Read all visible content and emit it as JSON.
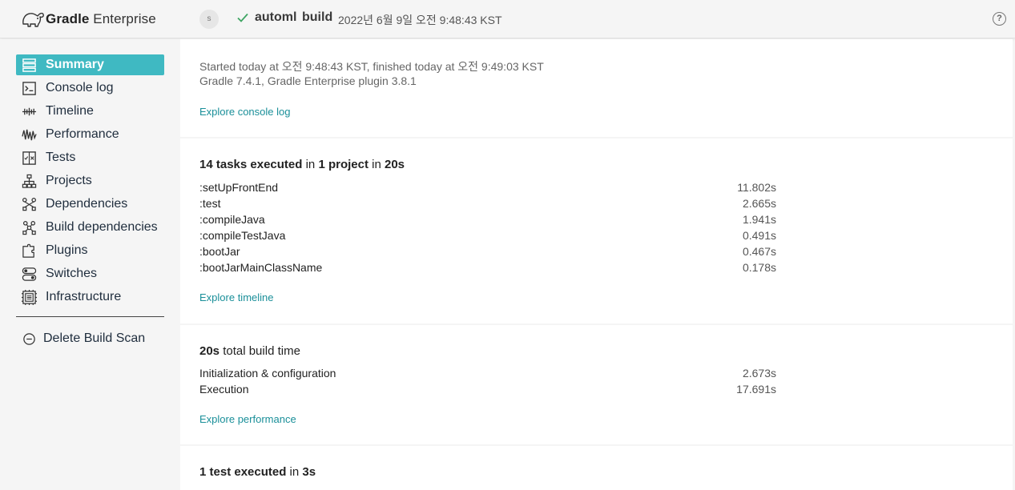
{
  "header": {
    "logo_brand": "Gradle",
    "logo_product": "Enterprise",
    "avatar_initial": "s",
    "project": "automl",
    "task": "build",
    "timestamp": "2022년 6월 9일 오전 9:48:43 KST",
    "help_label": "?",
    "colors": {
      "success": "#3fa564",
      "accent": "#3fb9c2",
      "link": "#1a8f99"
    }
  },
  "sidebar": {
    "items": [
      {
        "label": "Summary",
        "icon": "summary-icon",
        "active": true
      },
      {
        "label": "Console log",
        "icon": "console-icon",
        "active": false
      },
      {
        "label": "Timeline",
        "icon": "timeline-icon",
        "active": false
      },
      {
        "label": "Performance",
        "icon": "performance-icon",
        "active": false
      },
      {
        "label": "Tests",
        "icon": "tests-icon",
        "active": false
      },
      {
        "label": "Projects",
        "icon": "projects-icon",
        "active": false
      },
      {
        "label": "Dependencies",
        "icon": "dependencies-icon",
        "active": false
      },
      {
        "label": "Build dependencies",
        "icon": "build-dependencies-icon",
        "active": false
      },
      {
        "label": "Plugins",
        "icon": "plugins-icon",
        "active": false
      },
      {
        "label": "Switches",
        "icon": "switches-icon",
        "active": false
      },
      {
        "label": "Infrastructure",
        "icon": "infrastructure-icon",
        "active": false
      }
    ],
    "delete_label": "Delete Build Scan"
  },
  "overview": {
    "started": "Started today at 오전 9:48:43 KST, finished today at 오전 9:49:03 KST",
    "versions": "Gradle 7.4.1,  Gradle Enterprise plugin 3.8.1",
    "link": "Explore console log"
  },
  "tasks": {
    "title_count": "14 tasks executed",
    "title_mid1": " in ",
    "title_projects": "1 project",
    "title_mid2": " in ",
    "title_time": "20s",
    "rows": [
      {
        "name": ":setUpFrontEnd",
        "value": "11.802s"
      },
      {
        "name": ":test",
        "value": "2.665s"
      },
      {
        "name": ":compileJava",
        "value": "1.941s"
      },
      {
        "name": ":compileTestJava",
        "value": "0.491s"
      },
      {
        "name": ":bootJar",
        "value": "0.467s"
      },
      {
        "name": ":bootJarMainClassName",
        "value": "0.178s"
      }
    ],
    "link": "Explore timeline"
  },
  "performance": {
    "title_time": "20s",
    "title_rest": " total build time",
    "rows": [
      {
        "name": "Initialization & configuration",
        "value": "2.673s"
      },
      {
        "name": "Execution",
        "value": "17.691s"
      }
    ],
    "link": "Explore performance"
  },
  "tests": {
    "title_count": "1 test executed",
    "title_mid": " in ",
    "title_time": "3s"
  }
}
